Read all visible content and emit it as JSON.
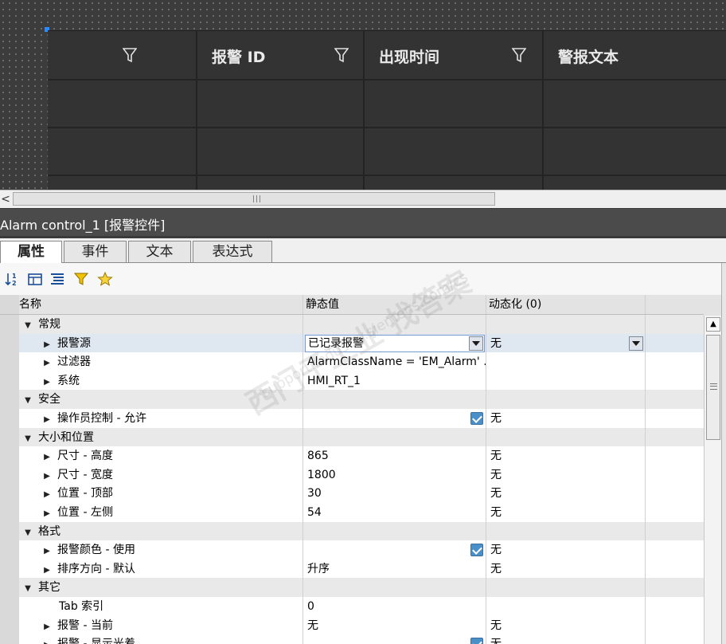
{
  "alarm_table": {
    "columns": [
      {
        "label": ""
      },
      {
        "label": "报警 ID"
      },
      {
        "label": "出现时间"
      },
      {
        "label": "警报文本"
      }
    ]
  },
  "hscroll": {
    "left_arrow": "<",
    "grip": "|||"
  },
  "panel_title": "Alarm control_1 [报警控件]",
  "tabs": [
    "属性",
    "事件",
    "文本",
    "表达式"
  ],
  "toolbar": {
    "icons": [
      "sort-icon",
      "categories-icon",
      "alphabetical-list-icon",
      "filter-icon",
      "favorites-icon"
    ]
  },
  "grid": {
    "headers": {
      "name": "名称",
      "static": "静态值",
      "dynamic": "动态化 (0)"
    },
    "rows": [
      {
        "kind": "group",
        "name": "常规"
      },
      {
        "kind": "item",
        "name": "报警源",
        "static": "已记录报警",
        "dynamic": "无",
        "combo": true,
        "selected": true
      },
      {
        "kind": "item",
        "name": "过滤器",
        "static": "AlarmClassName = 'EM_Alarm' ...",
        "dynamic": ""
      },
      {
        "kind": "item",
        "name": "系统",
        "static": "HMI_RT_1",
        "dynamic": ""
      },
      {
        "kind": "group",
        "name": "安全"
      },
      {
        "kind": "item",
        "name": "操作员控制 - 允许",
        "static": "",
        "checked": true,
        "dynamic": "无"
      },
      {
        "kind": "group",
        "name": "大小和位置"
      },
      {
        "kind": "item",
        "name": "尺寸 - 高度",
        "static": "865",
        "dynamic": "无"
      },
      {
        "kind": "item",
        "name": "尺寸 - 宽度",
        "static": "1800",
        "dynamic": "无"
      },
      {
        "kind": "item",
        "name": "位置 - 顶部",
        "static": "30",
        "dynamic": "无"
      },
      {
        "kind": "item",
        "name": "位置 - 左侧",
        "static": "54",
        "dynamic": "无"
      },
      {
        "kind": "group",
        "name": "格式"
      },
      {
        "kind": "item",
        "name": "报警颜色 - 使用",
        "static": "",
        "checked": true,
        "dynamic": "无"
      },
      {
        "kind": "item",
        "name": "排序方向 - 默认",
        "static": "升序",
        "dynamic": "无"
      },
      {
        "kind": "group",
        "name": "其它"
      },
      {
        "kind": "leaf",
        "name": "Tab 索引",
        "static": "0",
        "dynamic": ""
      },
      {
        "kind": "item",
        "name": "报警 - 当前",
        "static": "无",
        "dynamic": "无"
      },
      {
        "kind": "item",
        "name": "报警 - 显示光着",
        "static": "",
        "checked": true,
        "dynamic": "无"
      }
    ]
  },
  "watermark": {
    "line1": "西门子工业  找答案",
    "line2": "support.industry.siemens.com/cs"
  },
  "colors": {
    "accent": "#2a8cff",
    "checkbox": "#4a90c8",
    "selected_row": "#dfe7f1",
    "group_row": "#e9e9e9"
  }
}
